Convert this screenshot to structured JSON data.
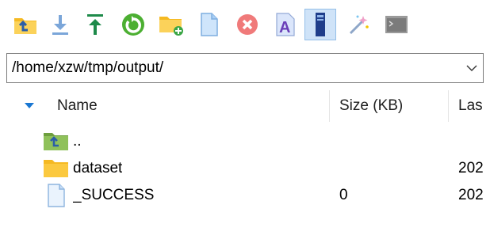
{
  "toolbar": {
    "buttons": [
      {
        "icon": "parent-folder-icon"
      },
      {
        "icon": "download-icon"
      },
      {
        "icon": "upload-icon"
      },
      {
        "icon": "refresh-icon"
      },
      {
        "icon": "new-folder-icon"
      },
      {
        "icon": "new-file-icon"
      },
      {
        "icon": "delete-icon"
      },
      {
        "icon": "rename-icon"
      },
      {
        "icon": "properties-icon",
        "active": true
      },
      {
        "icon": "magic-wand-icon"
      },
      {
        "icon": "terminal-icon"
      }
    ]
  },
  "pathbar": {
    "value": "/home/xzw/tmp/output/"
  },
  "columns": {
    "name": "Name",
    "size": "Size (KB)",
    "last": "Las"
  },
  "rows": [
    {
      "name": "..",
      "size": "",
      "date": "",
      "icon": "parent-folder-icon"
    },
    {
      "name": "dataset",
      "size": "",
      "date": "202",
      "icon": "folder-icon"
    },
    {
      "name": "_SUCCESS",
      "size": "0",
      "date": "202",
      "icon": "file-icon"
    }
  ],
  "colors": {
    "active_button_bg": "#cfe3f8",
    "folder_yellow": "#f8c63c",
    "accent_blue": "#1a77d2"
  }
}
